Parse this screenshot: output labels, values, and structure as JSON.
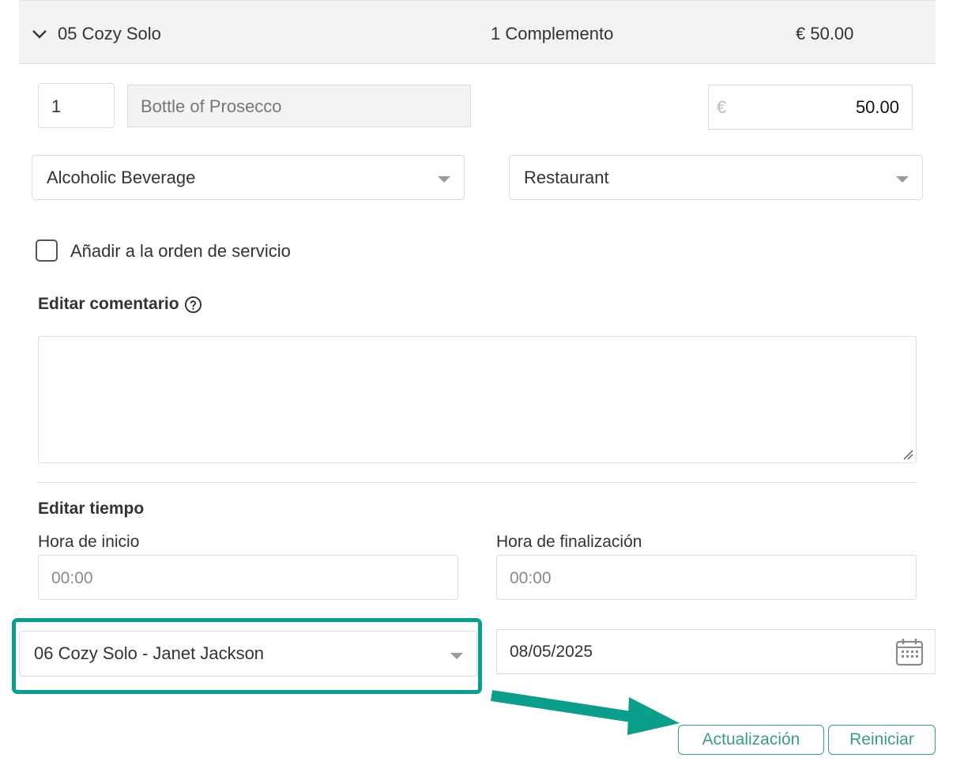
{
  "header": {
    "room_name": "05 Cozy Solo",
    "addon_count": "1 Complemento",
    "total": "€ 50.00"
  },
  "item": {
    "quantity": "1",
    "name": "Bottle of Prosecco",
    "currency_symbol": "€",
    "price": "50.00"
  },
  "category_select": {
    "selected": "Alcoholic Beverage"
  },
  "department_select": {
    "selected": "Restaurant"
  },
  "service_order_checkbox": {
    "label": "Añadir a la orden de servicio",
    "checked": false
  },
  "comment": {
    "title": "Editar comentario",
    "value": ""
  },
  "time": {
    "title": "Editar tiempo",
    "start_label": "Hora de inicio",
    "start_placeholder": "00:00",
    "end_label": "Hora de finalización",
    "end_placeholder": "00:00"
  },
  "room_select": {
    "selected": "06 Cozy Solo - Janet Jackson"
  },
  "date": {
    "value": "08/05/2025"
  },
  "buttons": {
    "update": "Actualización",
    "reset": "Reiniciar"
  },
  "colors": {
    "accent": "#0b9e8a",
    "button": "#3d9a8e"
  },
  "icons": [
    "chevron-down-icon",
    "help-circle-icon",
    "calendar-icon",
    "arrow-right-icon"
  ]
}
